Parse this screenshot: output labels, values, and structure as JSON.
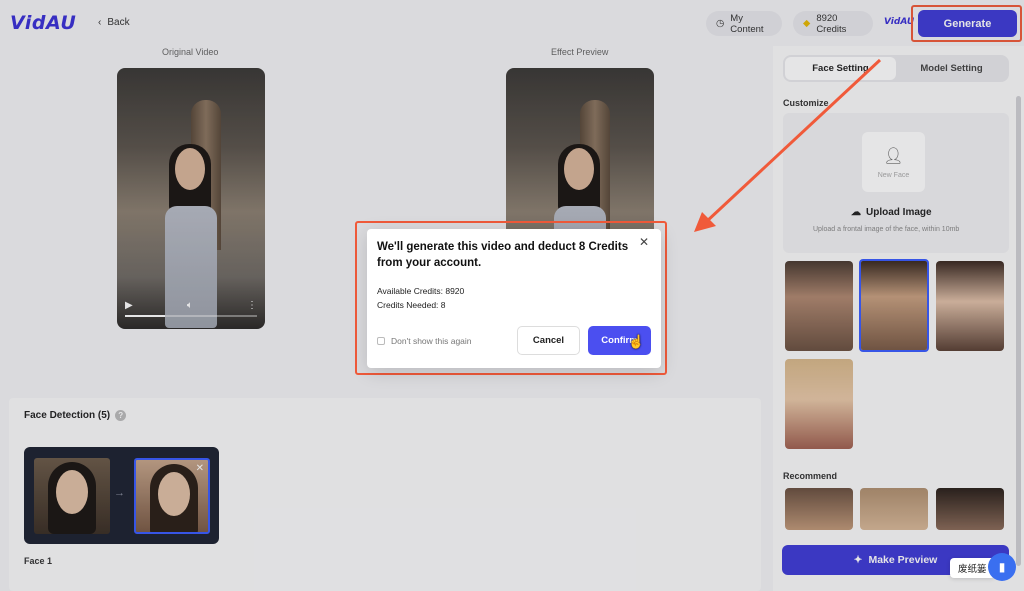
{
  "header": {
    "logo": "VidAU",
    "back_label": "Back",
    "my_content_label": "My Content",
    "credits_label": "8920 Credits",
    "mini_logo": "VidAU",
    "generate_label": "Generate"
  },
  "videos": {
    "original_label": "Original Video",
    "preview_label": "Effect Preview"
  },
  "face_detection": {
    "title": "Face Detection (5)",
    "face_label": "Face 1"
  },
  "right_panel": {
    "tabs": [
      "Face Setting",
      "Model Setting"
    ],
    "customize_label": "Customize",
    "new_face_label": "New Face",
    "upload_title": "Upload Image",
    "upload_hint": "Upload a frontal image of the face, within 10mb",
    "recommend_label": "Recommend",
    "make_preview_label": "Make Preview"
  },
  "modal": {
    "title": "We'll generate this video and deduct 8 Credits from your account.",
    "available_credits": "Available Credits: 8920",
    "credits_needed": "Credits Needed: 8",
    "dont_show_label": "Don't show this again",
    "cancel_label": "Cancel",
    "confirm_label": "Confirm"
  },
  "floating": {
    "label": "废纸篓"
  },
  "colors": {
    "accent": "#3e3bd6",
    "highlight": "#f05a3a"
  }
}
